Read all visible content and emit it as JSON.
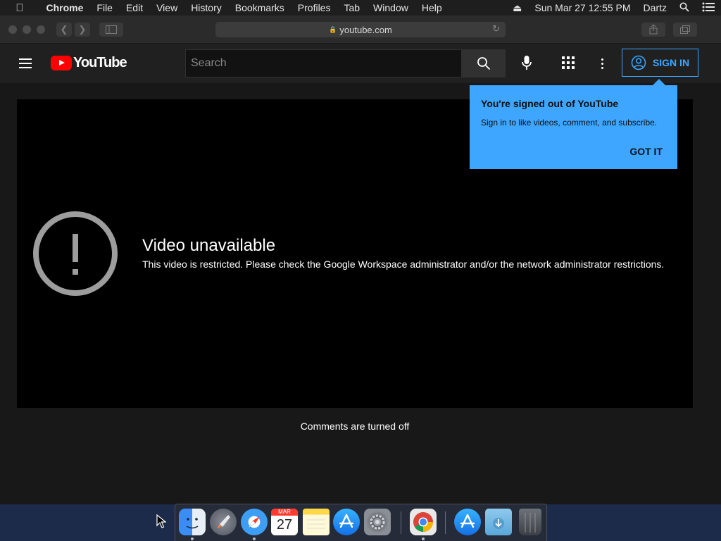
{
  "menubar": {
    "apple_icon": "apple-icon",
    "items": [
      "Chrome",
      "File",
      "Edit",
      "View",
      "History",
      "Bookmarks",
      "Profiles",
      "Tab",
      "Window",
      "Help"
    ],
    "datetime": "Sun Mar 27  12:55 PM",
    "user": "Dartz"
  },
  "browser": {
    "url": "youtube.com"
  },
  "youtube": {
    "logo_text": "YouTube",
    "search_placeholder": "Search",
    "sign_in_label": "SIGN IN",
    "player": {
      "error_title": "Video unavailable",
      "error_message": "This video is restricted. Please check the Google Workspace administrator and/or the network administrator restrictions."
    },
    "comments_status": "Comments are turned off",
    "signin_popup": {
      "title": "You're signed out of YouTube",
      "body": "Sign in to like videos, comment, and subscribe.",
      "dismiss_label": "GOT IT"
    }
  },
  "dock": {
    "calendar_month": "MAR",
    "calendar_day": "27",
    "apps": [
      "finder-icon",
      "launchpad-icon",
      "safari-icon",
      "calendar-icon",
      "notes-icon",
      "app-store-icon",
      "system-preferences-icon",
      "chrome-icon",
      "app-store-downloads-icon",
      "downloads-folder-icon",
      "trash-icon"
    ]
  },
  "colors": {
    "accent_blue": "#3ea6ff",
    "youtube_red": "#ff0000",
    "page_bg": "#181818",
    "header_bg": "#202020"
  }
}
